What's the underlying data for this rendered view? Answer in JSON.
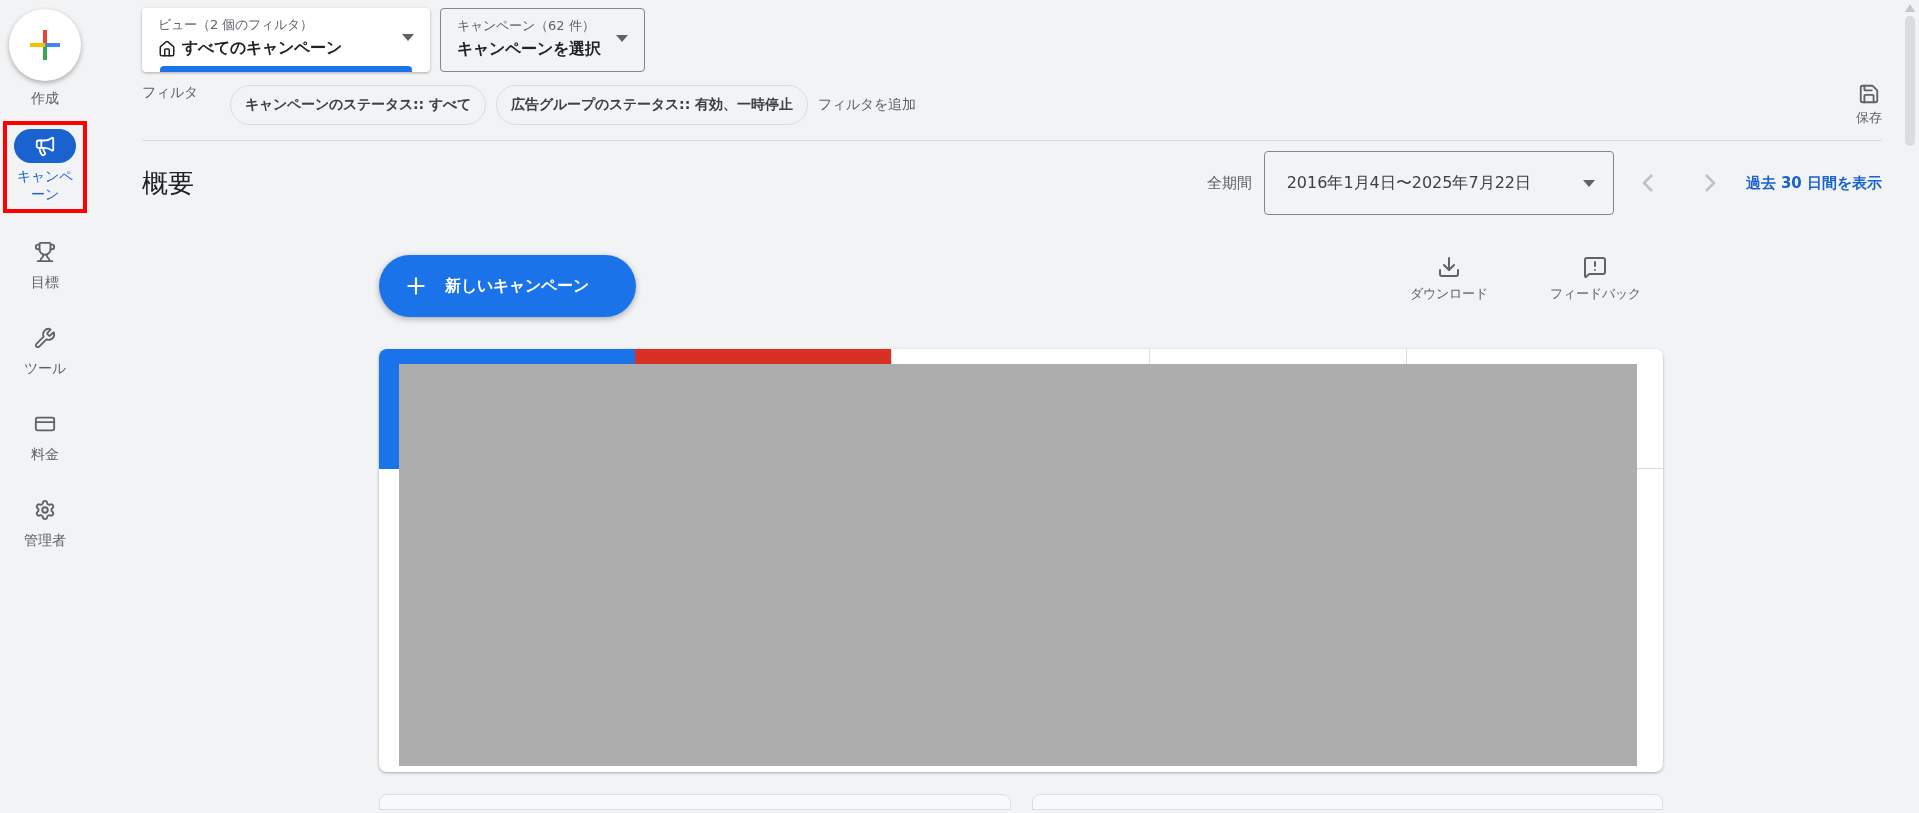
{
  "sidebar": {
    "create": {
      "label": "作成"
    },
    "items": [
      {
        "kind": "campaigns",
        "label": "キャンペーン",
        "selected": true,
        "highlighted": true
      },
      {
        "kind": "goals",
        "label": "目標",
        "selected": false,
        "highlighted": false
      },
      {
        "kind": "tools",
        "label": "ツール",
        "selected": false,
        "highlighted": false
      },
      {
        "kind": "billing",
        "label": "料金",
        "selected": false,
        "highlighted": false
      },
      {
        "kind": "admin",
        "label": "管理者",
        "selected": false,
        "highlighted": false
      }
    ]
  },
  "view_selector": {
    "label": "ビュー（2 個のフィルタ）",
    "value": "すべてのキャンペーン"
  },
  "campaign_selector": {
    "label": "キャンペーン（62 件）",
    "value": "キャンペーンを選択"
  },
  "filters": {
    "label": "フィルタ",
    "chips": [
      "キャンペーンのステータス:: すべて",
      "広告グループのステータス:: 有効、一時停止"
    ],
    "add": "フィルタを追加"
  },
  "save": {
    "label": "保存"
  },
  "page_title": "概要",
  "date_range": {
    "label": "全期間",
    "value": "2016年1月4日〜2025年7月22日",
    "link": "過去 30 日間を表示"
  },
  "new_campaign_button": "新しいキャンペーン",
  "actions": [
    {
      "kind": "download",
      "label": "ダウンロード"
    },
    {
      "kind": "feedback",
      "label": "フィードバック"
    }
  ],
  "summary_card": {
    "metric_tabs": [
      {
        "selected": true,
        "color": "#1a73e8"
      },
      {
        "selected": true,
        "color": "#d93025"
      },
      {
        "selected": false,
        "color": "#ffffff"
      },
      {
        "selected": false,
        "color": "#ffffff"
      },
      {
        "selected": false,
        "color": "#ffffff"
      }
    ]
  }
}
